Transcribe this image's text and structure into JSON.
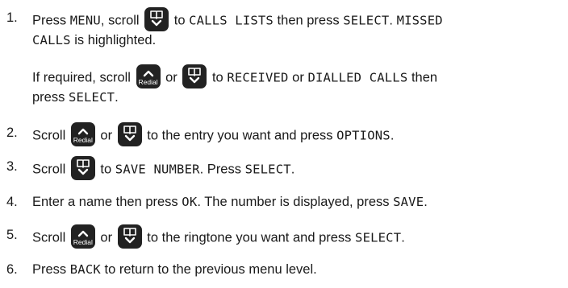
{
  "steps": [
    {
      "number": "1.",
      "parts": [
        {
          "t": "Press "
        },
        {
          "lcd": "MENU"
        },
        {
          "t": ", scroll "
        },
        {
          "icon": "down"
        },
        {
          "t": " to "
        },
        {
          "lcd": "CALLS LISTS"
        },
        {
          "t": " then press "
        },
        {
          "lcd": "SELECT"
        },
        {
          "t": ". "
        },
        {
          "lcd": "MISSED"
        }
      ]
    },
    {
      "number": "",
      "parts": [
        {
          "lcd": "CALLS"
        },
        {
          "t": " is highlighted."
        }
      ]
    },
    {
      "number": "",
      "parts": [
        {
          "t": "If required, scroll "
        },
        {
          "icon": "up"
        },
        {
          "t": " or "
        },
        {
          "icon": "down"
        },
        {
          "t": " to "
        },
        {
          "lcd": "RECEIVED"
        },
        {
          "t": " or "
        },
        {
          "lcd": "DIALLED CALLS"
        },
        {
          "t": " then"
        }
      ]
    },
    {
      "number": "",
      "parts": [
        {
          "t": "press "
        },
        {
          "lcd": "SELECT"
        },
        {
          "t": "."
        }
      ]
    },
    {
      "number": "2.",
      "parts": [
        {
          "t": "Scroll "
        },
        {
          "icon": "up"
        },
        {
          "t": " or "
        },
        {
          "icon": "down"
        },
        {
          "t": " to the entry you want and press "
        },
        {
          "lcd": "OPTIONS"
        },
        {
          "t": "."
        }
      ]
    },
    {
      "number": "3.",
      "parts": [
        {
          "t": "Scroll "
        },
        {
          "icon": "down"
        },
        {
          "t": " to "
        },
        {
          "lcd": "SAVE NUMBER"
        },
        {
          "t": ". Press "
        },
        {
          "lcd": "SELECT"
        },
        {
          "t": "."
        }
      ]
    },
    {
      "number": "4.",
      "parts": [
        {
          "t": "Enter a name then press "
        },
        {
          "lcd": "OK"
        },
        {
          "t": ". The number is displayed, press "
        },
        {
          "lcd": "SAVE"
        },
        {
          "t": "."
        }
      ]
    },
    {
      "number": "5.",
      "parts": [
        {
          "t": "Scroll "
        },
        {
          "icon": "up"
        },
        {
          "t": " or "
        },
        {
          "icon": "down"
        },
        {
          "t": " to the ringtone you want and press "
        },
        {
          "lcd": "SELECT"
        },
        {
          "t": "."
        }
      ]
    },
    {
      "number": "6.",
      "parts": [
        {
          "t": "Press "
        },
        {
          "lcd": "BACK"
        },
        {
          "t": " to return to the previous menu level."
        }
      ]
    }
  ],
  "icons": {
    "up": {
      "name": "redial-up-button-icon",
      "label": "Redial"
    },
    "down": {
      "name": "phonebook-down-button-icon",
      "label": ""
    }
  },
  "colors": {
    "text": "#1a1a1a",
    "button": "#222222",
    "button_symbol": "#ffffff"
  }
}
